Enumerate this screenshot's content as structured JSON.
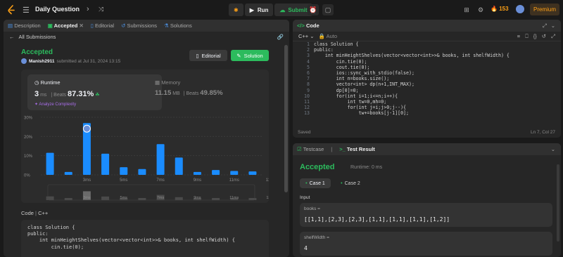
{
  "topbar": {
    "title": "Daily Question",
    "run": "Run",
    "submit": "Submit",
    "streak": "153",
    "premium": "Premium"
  },
  "left": {
    "tabs": [
      {
        "label": "Description"
      },
      {
        "label": "Accepted"
      },
      {
        "label": "Editorial"
      },
      {
        "label": "Submissions"
      },
      {
        "label": "Solutions"
      }
    ],
    "back": "All Submissions",
    "status": "Accepted",
    "user": "Manish2911",
    "submitted": "submitted at Jul 31, 2024 13:15",
    "editorial_btn": "Editorial",
    "solution_btn": "Solution",
    "runtime": {
      "label": "Runtime",
      "value": "3",
      "unit": "ms",
      "beats_label": "Beats",
      "beats": "87.31%",
      "analyze": "Analyze Complexity"
    },
    "memory": {
      "label": "Memory",
      "value": "11.15",
      "unit": "MB",
      "beats_label": "Beats",
      "beats": "49.85%"
    },
    "code_label": "Code",
    "lang": "C++",
    "code_lines": [
      "class Solution {",
      "public:",
      "    int minHeightShelves(vector<vector<int>>& books, int shelfWidth) {",
      "        cin.tie(0);"
    ]
  },
  "chart_data": {
    "type": "bar",
    "y_ticks": [
      "30%",
      "20%",
      "10%",
      "0%"
    ],
    "ylim": [
      0,
      30
    ],
    "x_ticks": [
      "3ms",
      "5ms",
      "7ms",
      "9ms",
      "11ms",
      "13ms"
    ],
    "values": [
      11.5,
      1.5,
      27,
      11,
      4,
      3,
      16,
      9,
      1.5,
      2.5,
      2,
      1.8
    ],
    "highlight_index": 2
  },
  "code_panel": {
    "title": "Code",
    "lang": "C++",
    "mode": "Auto",
    "status": "Saved",
    "cursor": "Ln 7, Col 27",
    "line_numbers": [
      "1",
      "2",
      "3",
      "4",
      "5",
      "6",
      "7",
      "8",
      "9",
      "10",
      "11",
      "12",
      "13"
    ],
    "lines": [
      "class Solution {",
      "public:",
      "    int minHeightShelves(vector<vector<int>>& books, int shelfWidth) {",
      "        cin.tie(0);",
      "        cout.tie(0);",
      "        ios::sync_with_stdio(false);",
      "        int n=books.size();",
      "        vector<int> dp(n+1,INT_MAX);",
      "        dp[0]=0;",
      "        for(int i=1;i<=n;i++){",
      "            int tw=0,mh=0;",
      "            for(int j=i;j>0;j--){",
      "                tw+=books[j-1][0];"
    ]
  },
  "result": {
    "tab_testcase": "Testcase",
    "tab_result": "Test Result",
    "status": "Accepted",
    "runtime": "Runtime: 0 ms",
    "cases": [
      "Case 1",
      "Case 2"
    ],
    "input_label": "Input",
    "books_label": "books =",
    "books_value": "[[1,1],[2,3],[2,3],[1,1],[1,1],[1,1],[1,2]]",
    "width_label": "shelfWidth =",
    "width_value": "4"
  }
}
